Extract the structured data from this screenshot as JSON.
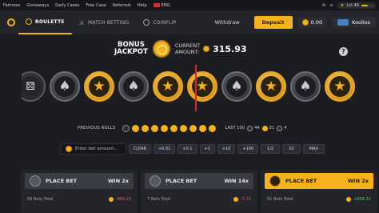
{
  "topbar": {
    "links": [
      "Fairness",
      "Giveaways",
      "Daily Cases",
      "Free Case",
      "Referrals",
      "Help"
    ],
    "lang": "ENG",
    "level": "Lvl 46",
    "level_progress": 0.55
  },
  "nav": {
    "tabs": [
      {
        "label": "ROULETTE",
        "active": true
      },
      {
        "label": "MATCH BETTING",
        "active": false
      },
      {
        "label": "COINFLIP",
        "active": false
      }
    ],
    "withdraw": "Withdraw",
    "deposit": "Deposit",
    "balance": "0.00",
    "username": "Koolios"
  },
  "jackpot": {
    "title_line1": "BONUS",
    "title_line2": "JACKPOT",
    "current_line1": "CURRENT",
    "current_line2": "AMOUNT:",
    "amount": "315.93",
    "help": "?"
  },
  "strip": {
    "slots": [
      "dice",
      "gray",
      "gold",
      "gray",
      "gold",
      "gold",
      "gray",
      "gold",
      "gray",
      "gold",
      "gray"
    ]
  },
  "previous": {
    "label": "PREVIOUS ROLLS",
    "rolls": [
      "s",
      "g",
      "g",
      "g",
      "g",
      "g",
      "g",
      "g",
      "g",
      "g"
    ],
    "last_label": "LAST 100",
    "counts": {
      "silver": "44",
      "gold": "51",
      "dice": "4"
    }
  },
  "bet": {
    "placeholder": "Enter bet amount...",
    "chips": [
      "CLEAR",
      "+0.01",
      "+0.1",
      "+1",
      "+10",
      "+100",
      "1/2",
      "X2",
      "MAX"
    ]
  },
  "panels": [
    {
      "label": "PLACE BET",
      "win": "WIN 2x",
      "total": "69 Bets Total",
      "amount": "-889.25",
      "sign": "neg"
    },
    {
      "label": "PLACE BET",
      "win": "WIN 14x",
      "total": "7 Bets Total",
      "amount": "-7.21",
      "sign": "neg"
    },
    {
      "label": "PLACE BET",
      "win": "WIN 2x",
      "total": "91 Bets Total",
      "amount": "+856.31",
      "sign": "pos"
    }
  ],
  "colors": {
    "accent": "#f5b21b",
    "background": "#1c1d21",
    "marker": "#e0262d"
  }
}
